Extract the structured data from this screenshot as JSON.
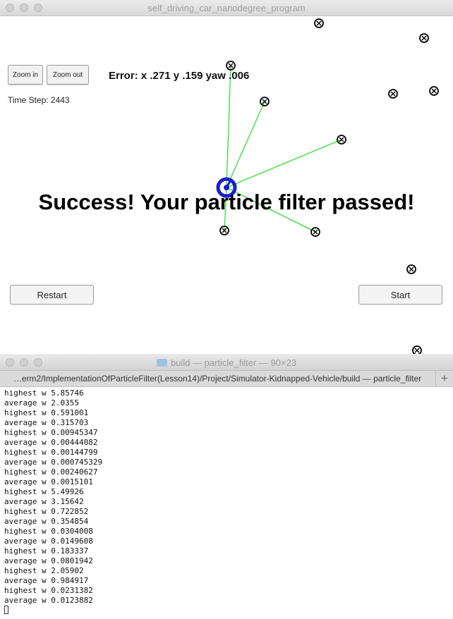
{
  "sim_window": {
    "title": "self_driving_car_nanodegree_program",
    "zoom_in_label": "Zoom in",
    "zoom_out_label": "Zoom out",
    "error_text": "Error: x .271 y .159 yaw .006",
    "time_step_text": "Time Step: 2443",
    "success_text": "Success! Your particle filter passed!",
    "restart_label": "Restart",
    "start_label": "Start",
    "colors": {
      "observation_line": "#33dd33",
      "car_ring": "#1e1ec8",
      "landmark": "#000000"
    }
  },
  "terminal": {
    "title": "build — particle_filter — 90×23",
    "tab_title": "…erm2/ImplementationOfParticleFilter(Lesson14)/Project/Simulator-Kidnapped-Vehicle/build — particle_filter",
    "new_tab_label": "+",
    "lines": [
      "highest w 5.85746",
      "average w 2.0355",
      "highest w 0.591001",
      "average w 0.315703",
      "highest w 0.00945347",
      "average w 0.00444082",
      "highest w 0.00144799",
      "average w 0.000745329",
      "highest w 0.00240627",
      "average w 0.0015101",
      "highest w 5.49926",
      "average w 3.15642",
      "highest w 0.722852",
      "average w 0.354854",
      "highest w 0.0304008",
      "average w 0.0149608",
      "highest w 0.183337",
      "average w 0.0801942",
      "highest w 2.05902",
      "average w 0.984917",
      "highest w 0.0231382",
      "average w 0.0123882"
    ]
  }
}
